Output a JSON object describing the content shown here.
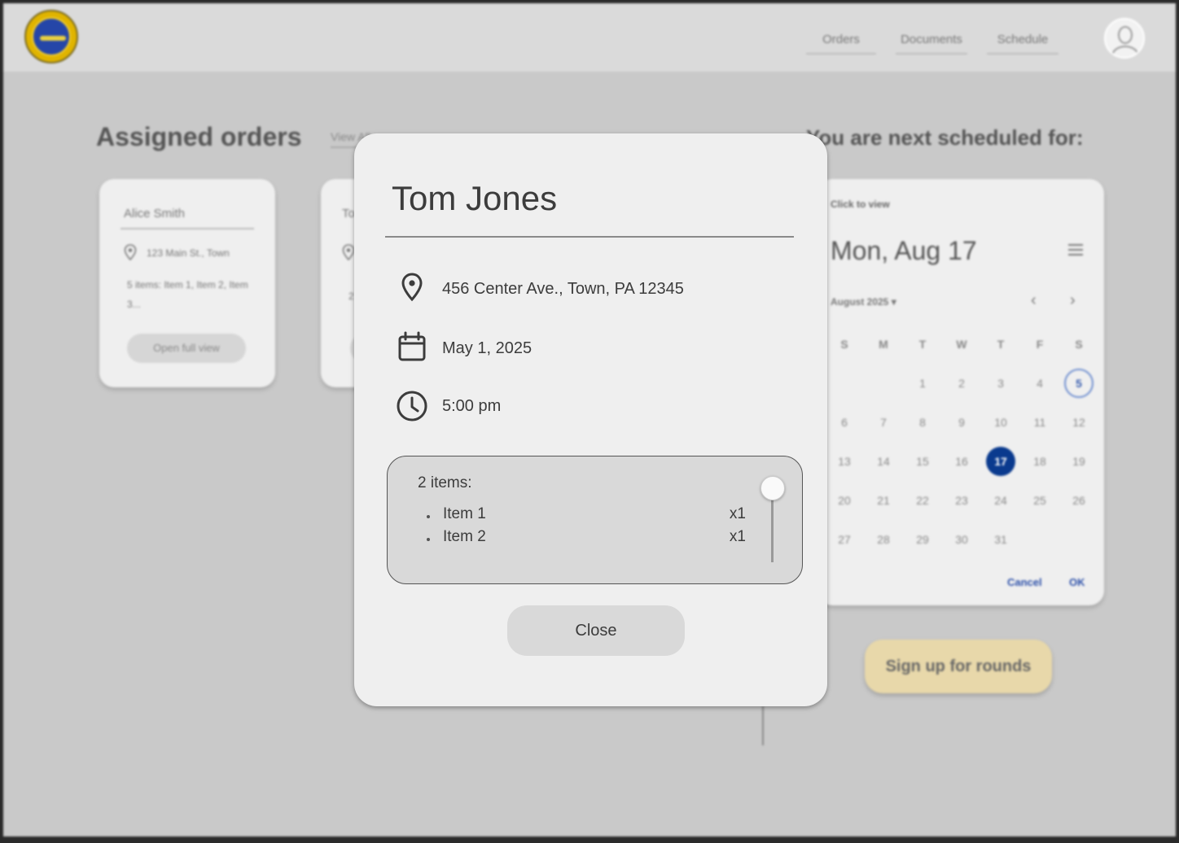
{
  "nav": {
    "links": [
      "Orders",
      "Documents",
      "Schedule"
    ]
  },
  "orders": {
    "heading": "Assigned orders",
    "view_all": "View All",
    "cards": [
      {
        "name": "Alice Smith",
        "address": "123 Main St., Town",
        "items": "5 items: Item 1, Item 2, Item 3...",
        "button": "Open full view"
      },
      {
        "name": "To",
        "address": "",
        "items": "2",
        "button": ""
      }
    ]
  },
  "schedule": {
    "heading": "You are next scheduled for:",
    "hint": "Click to view",
    "selected_date": "Mon, Aug 17",
    "month_label": "August 2025",
    "weekdays": [
      "S",
      "M",
      "T",
      "W",
      "T",
      "F",
      "S"
    ],
    "days": [
      "1",
      "2",
      "3",
      "4",
      "5",
      "6",
      "7",
      "8",
      "9",
      "10",
      "11",
      "12",
      "13",
      "14",
      "15",
      "16",
      "17",
      "18",
      "19",
      "20",
      "21",
      "22",
      "23",
      "24",
      "25",
      "26",
      "27",
      "28",
      "29",
      "30",
      "31"
    ],
    "first_weekday_index": 2,
    "today": "17",
    "outlined": "5",
    "cancel": "Cancel",
    "ok": "OK",
    "signup": "Sign up for rounds"
  },
  "modal": {
    "title": "Tom Jones",
    "address": "456 Center Ave., Town, PA 12345",
    "date": "May 1, 2025",
    "time": "5:00 pm",
    "items_title": "2 items:",
    "items": [
      {
        "label": "Item 1",
        "qty": "x1"
      },
      {
        "label": "Item 2",
        "qty": "x1"
      }
    ],
    "close": "Close"
  },
  "colors": {
    "accent": "#0a3a8e",
    "signup_button": "#e8d8aa",
    "overlay": "#c9c9c9"
  }
}
